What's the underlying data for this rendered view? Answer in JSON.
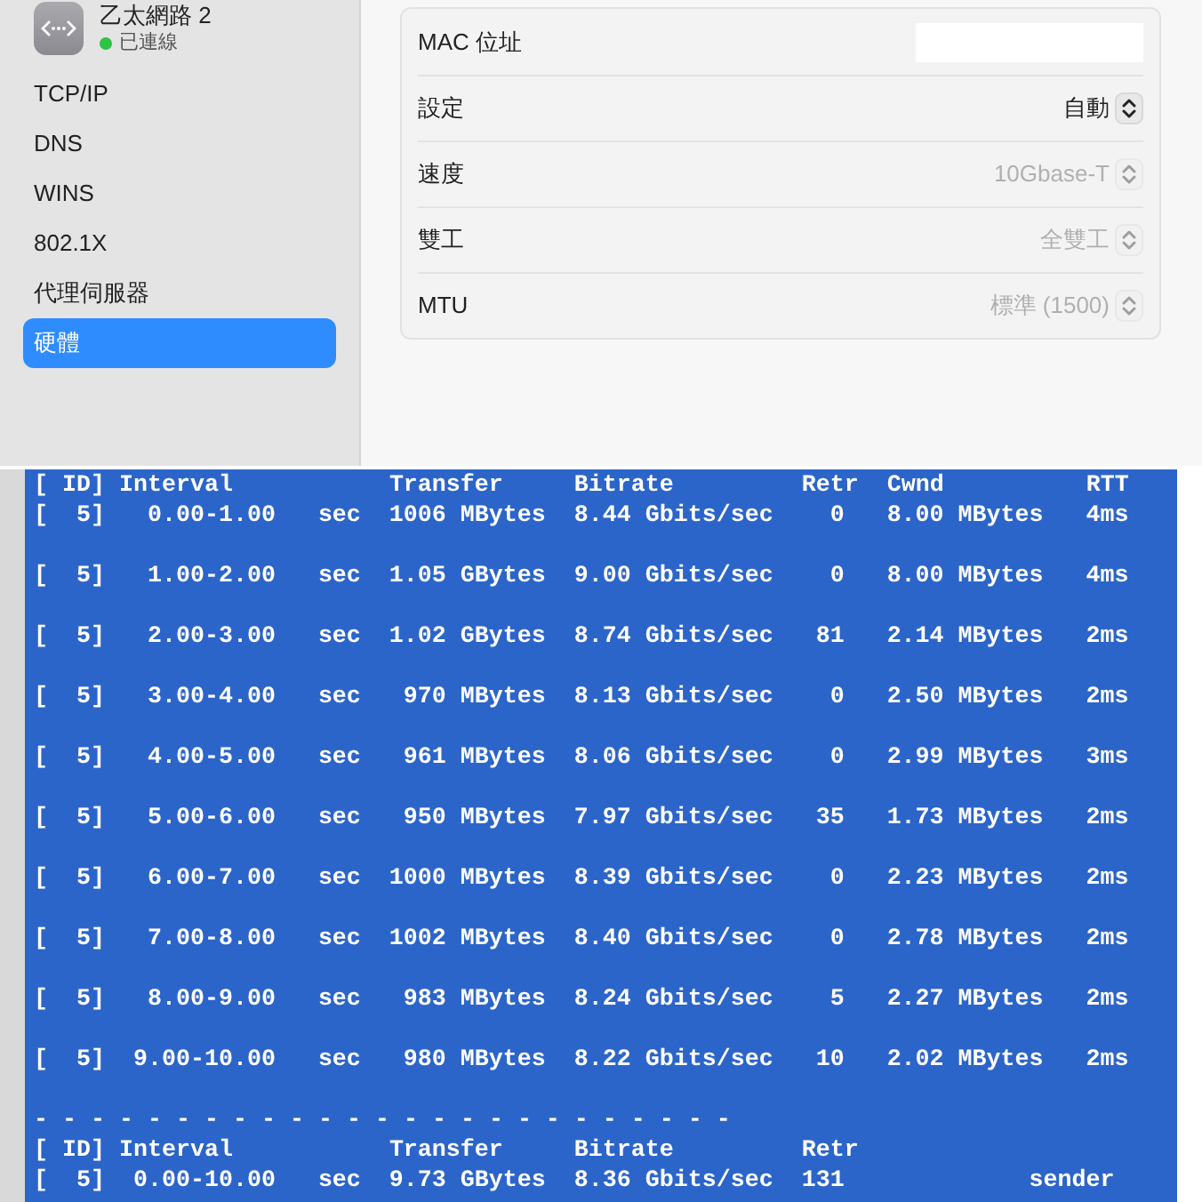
{
  "sidebar": {
    "connection": {
      "title": "乙太網路 2",
      "status": "已連線",
      "connected": true
    },
    "items": [
      {
        "label": "TCP/IP",
        "selected": false
      },
      {
        "label": "DNS",
        "selected": false
      },
      {
        "label": "WINS",
        "selected": false
      },
      {
        "label": "802.1X",
        "selected": false
      },
      {
        "label": "代理伺服器",
        "selected": false
      },
      {
        "label": "硬體",
        "selected": true
      }
    ]
  },
  "hardware": {
    "rows": [
      {
        "kind": "hidden",
        "label": "MAC 位址"
      },
      {
        "kind": "popup",
        "label": "設定",
        "value": "自動",
        "disabled": false
      },
      {
        "kind": "popup",
        "label": "速度",
        "value": "10Gbase-T",
        "disabled": true
      },
      {
        "kind": "popup",
        "label": "雙工",
        "value": "全雙工",
        "disabled": true
      },
      {
        "kind": "popup",
        "label": "MTU",
        "value": "標準 (1500)",
        "disabled": true
      }
    ]
  },
  "terminal": {
    "header": {
      "id": "[ ID]",
      "interval": "Interval",
      "transfer": "Transfer",
      "bitrate": "Bitrate",
      "retr": "Retr",
      "cwnd": "Cwnd",
      "rtt": "RTT"
    },
    "rows": [
      {
        "id": "[  5]",
        "interval": "0.00-1.00",
        "unit": "sec",
        "transfer": "1006 MBytes",
        "bitrate": "8.44 Gbits/sec",
        "retr": "0",
        "cwnd": "8.00 MBytes",
        "rtt": "4ms"
      },
      {
        "id": "[  5]",
        "interval": "1.00-2.00",
        "unit": "sec",
        "transfer": "1.05 GBytes",
        "bitrate": "9.00 Gbits/sec",
        "retr": "0",
        "cwnd": "8.00 MBytes",
        "rtt": "4ms"
      },
      {
        "id": "[  5]",
        "interval": "2.00-3.00",
        "unit": "sec",
        "transfer": "1.02 GBytes",
        "bitrate": "8.74 Gbits/sec",
        "retr": "81",
        "cwnd": "2.14 MBytes",
        "rtt": "2ms"
      },
      {
        "id": "[  5]",
        "interval": "3.00-4.00",
        "unit": "sec",
        "transfer": "970 MBytes",
        "bitrate": "8.13 Gbits/sec",
        "retr": "0",
        "cwnd": "2.50 MBytes",
        "rtt": "2ms"
      },
      {
        "id": "[  5]",
        "interval": "4.00-5.00",
        "unit": "sec",
        "transfer": "961 MBytes",
        "bitrate": "8.06 Gbits/sec",
        "retr": "0",
        "cwnd": "2.99 MBytes",
        "rtt": "3ms"
      },
      {
        "id": "[  5]",
        "interval": "5.00-6.00",
        "unit": "sec",
        "transfer": "950 MBytes",
        "bitrate": "7.97 Gbits/sec",
        "retr": "35",
        "cwnd": "1.73 MBytes",
        "rtt": "2ms"
      },
      {
        "id": "[  5]",
        "interval": "6.00-7.00",
        "unit": "sec",
        "transfer": "1000 MBytes",
        "bitrate": "8.39 Gbits/sec",
        "retr": "0",
        "cwnd": "2.23 MBytes",
        "rtt": "2ms"
      },
      {
        "id": "[  5]",
        "interval": "7.00-8.00",
        "unit": "sec",
        "transfer": "1002 MBytes",
        "bitrate": "8.40 Gbits/sec",
        "retr": "0",
        "cwnd": "2.78 MBytes",
        "rtt": "2ms"
      },
      {
        "id": "[  5]",
        "interval": "8.00-9.00",
        "unit": "sec",
        "transfer": "983 MBytes",
        "bitrate": "8.24 Gbits/sec",
        "retr": "5",
        "cwnd": "2.27 MBytes",
        "rtt": "2ms"
      },
      {
        "id": "[  5]",
        "interval": "9.00-10.00",
        "unit": "sec",
        "transfer": "980 MBytes",
        "bitrate": "8.22 Gbits/sec",
        "retr": "10",
        "cwnd": "2.02 MBytes",
        "rtt": "2ms"
      }
    ],
    "separator": "- - - - - - - - - - - - - - - - - - - - - - - - -",
    "summary_header": {
      "id": "[ ID]",
      "interval": "Interval",
      "transfer": "Transfer",
      "bitrate": "Bitrate",
      "retr": "Retr"
    },
    "summary": {
      "id": "[  5]",
      "interval": "0.00-10.00",
      "unit": "sec",
      "transfer": "9.73 GBytes",
      "bitrate": "8.36 Gbits/sec",
      "retr": "131",
      "role": "sender"
    }
  }
}
